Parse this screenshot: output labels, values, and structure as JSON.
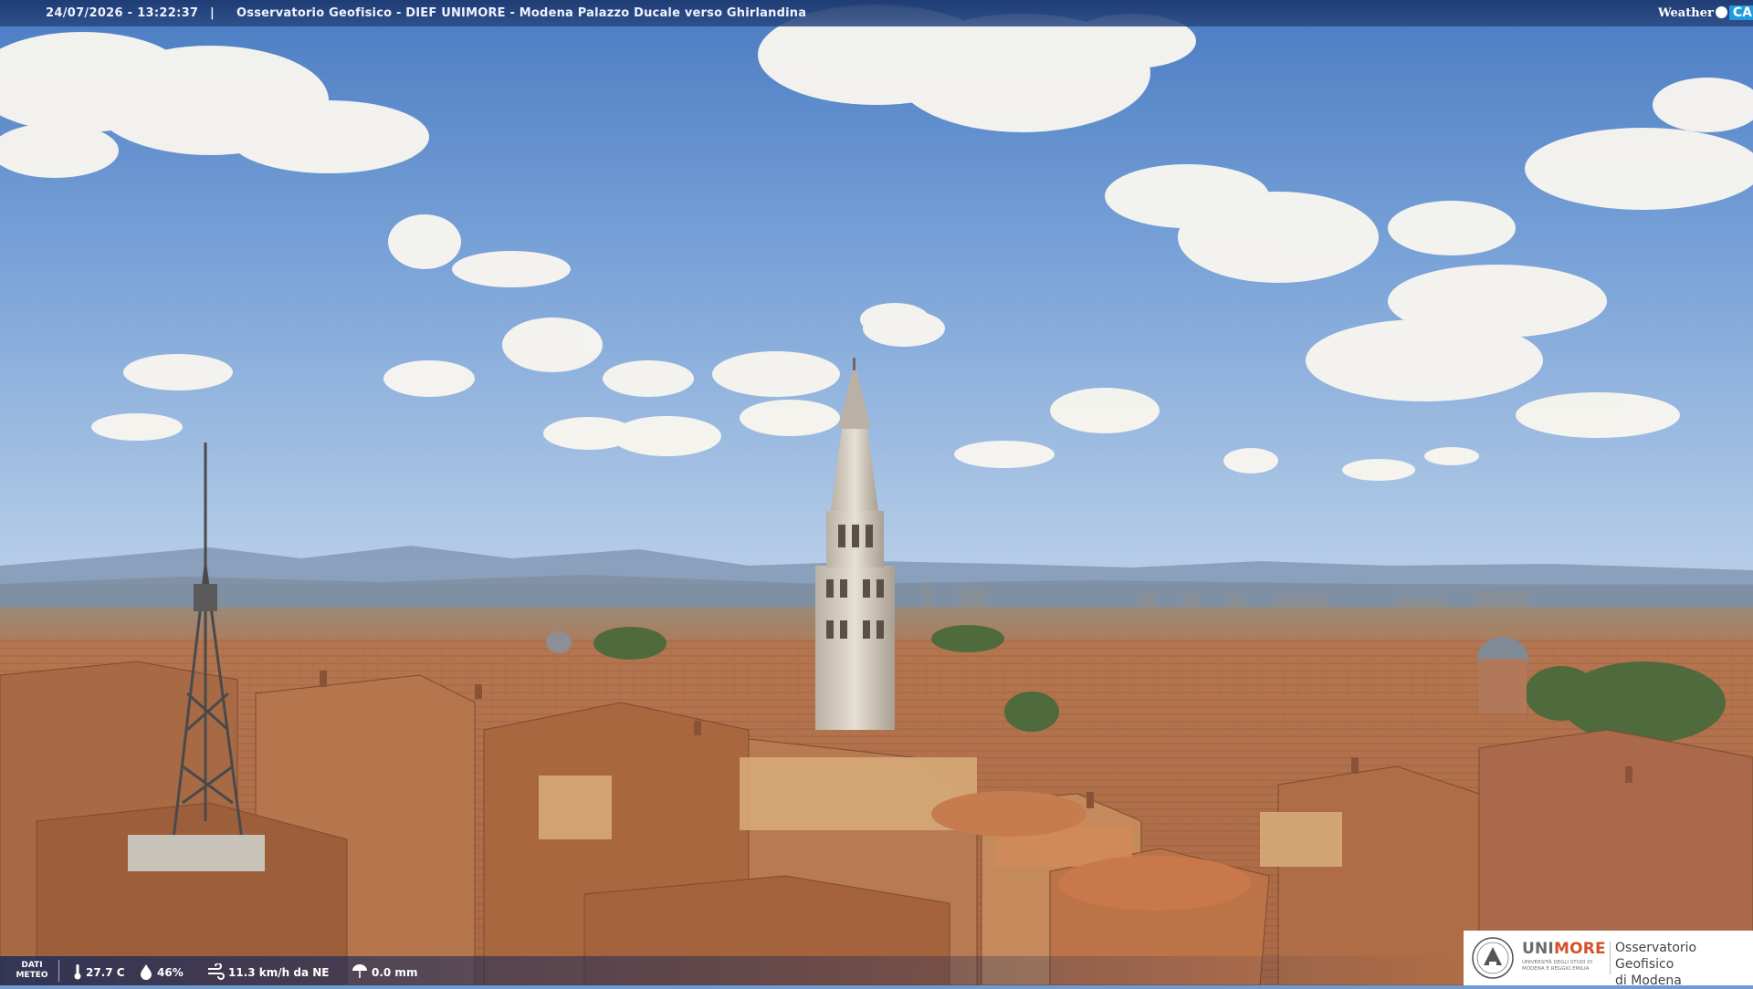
{
  "overlay": {
    "timestamp": "24/07/2026 - 13:22:37",
    "separator": "|",
    "location": "Osservatorio Geofisico - DIEF UNIMORE - Modena Palazzo Ducale verso Ghirlandina"
  },
  "brand_logo": {
    "weather": "Weather",
    "cam": "CAM"
  },
  "meteo": {
    "label": "DATI METEO",
    "temperature": "27.7 C",
    "humidity": "46%",
    "wind": "11.3 km/h da NE",
    "rain": "0.0 mm"
  },
  "logo_box": {
    "uni": "UNI",
    "more": "MORE",
    "university": "UNIVERSITÀ DEGLI STUDI DI MODENA E REGGIO EMILIA",
    "org_line1": "Osservatorio Geofisico",
    "org_line2": "di Modena"
  },
  "colors": {
    "sky_top": "#4f7fc4",
    "sky_horizon": "#a8c4e6",
    "roof": "#b7714a",
    "tower": "#d9d2c6",
    "bar": "#1c376e",
    "unimore_accent": "#d6502a"
  },
  "icons": {
    "temperature": "thermometer-icon",
    "humidity": "droplet-icon",
    "wind": "wind-icon",
    "rain": "rain-icon"
  }
}
